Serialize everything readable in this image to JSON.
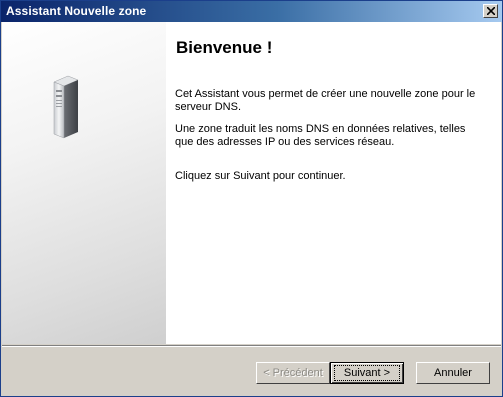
{
  "window": {
    "title": "Assistant Nouvelle zone"
  },
  "icons": {
    "close": "close-icon",
    "server": "server-icon"
  },
  "content": {
    "heading": "Bienvenue !",
    "paragraph1": "Cet Assistant vous permet de créer une nouvelle zone pour le serveur DNS.",
    "paragraph2": "Une zone traduit les noms DNS en données relatives, telles que des adresses IP ou des services réseau.",
    "paragraph3": "Cliquez sur Suivant pour continuer."
  },
  "buttons": {
    "previous": "< Précédent",
    "next": "Suivant >",
    "cancel": "Annuler"
  },
  "colors": {
    "titlebar_start": "#0a246a",
    "titlebar_end": "#a6caf0",
    "dialog_bg": "#d4d0c8"
  }
}
